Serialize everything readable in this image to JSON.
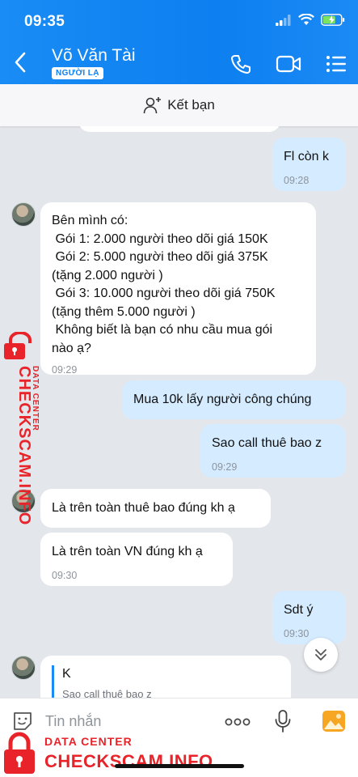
{
  "status_bar": {
    "time": "09:35"
  },
  "header": {
    "contact_name": "Võ Văn Tài",
    "stranger_tag": "NGƯỜI LẠ",
    "icons": [
      "back-icon",
      "phone-icon",
      "video-call-icon",
      "menu-icon"
    ]
  },
  "friend_bar": {
    "label": "Kết bạn",
    "icon": "add-friend-icon"
  },
  "messages": [
    {
      "side": "out",
      "text": "Fl còn k",
      "time": "09:28"
    },
    {
      "side": "in",
      "lines": [
        "Bên mình có:",
        " Gói 1: 2.000 người theo dõi giá 150K",
        " Gói 2: 5.000 người theo dõi giá 375K",
        "(tặng 2.000 người )",
        " Gói 3: 10.000 người theo dõi giá 750K",
        "(tặng thêm 5.000 người )",
        " Không biết là bạn có nhu cầu mua gói",
        "nào ạ?"
      ],
      "time": "09:29"
    },
    {
      "side": "out",
      "text": "Mua 10k lấy người công chúng"
    },
    {
      "side": "out",
      "text": "Sao call thuê bao z",
      "time": "09:29"
    },
    {
      "side": "in",
      "text": "Là trên toàn thuê bao đúng kh ạ"
    },
    {
      "side": "in",
      "text": "Là trên toàn VN đúng kh ạ",
      "time": "09:30"
    },
    {
      "side": "out",
      "text": "Sdt ý",
      "time": "09:30"
    },
    {
      "side": "in",
      "text": "K",
      "quote": "Sao call thuê bao z"
    }
  ],
  "composer": {
    "placeholder": "Tin nhắn"
  },
  "watermark": {
    "small": "DATA CENTER",
    "big": "CHECKSCAM.INFO"
  },
  "colors": {
    "header": "#0d7ff0",
    "bubble_out": "#d5ebff",
    "bubble_in": "#ffffff",
    "chat_bg": "#e3e6ea",
    "watermark": "#e8242a"
  }
}
